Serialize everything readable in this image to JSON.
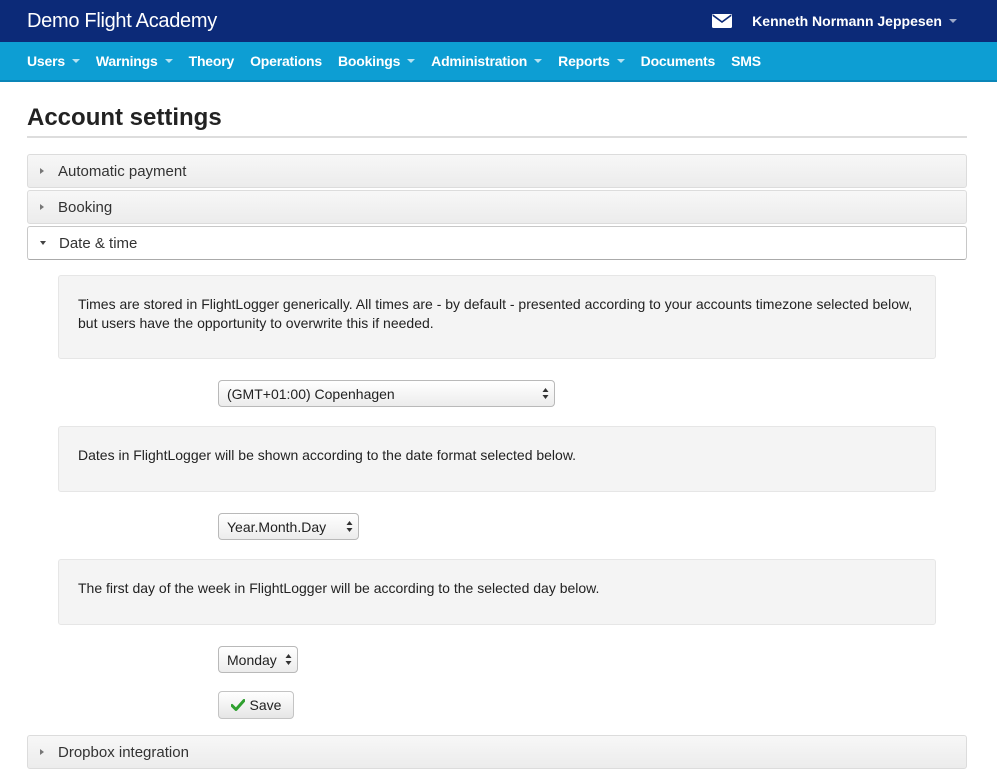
{
  "header": {
    "brand": "Demo Flight Academy",
    "user_name": "Kenneth Normann Jeppesen",
    "mail_icon": "mail-icon"
  },
  "nav": {
    "items": [
      {
        "label": "Users",
        "dropdown": true
      },
      {
        "label": "Warnings",
        "dropdown": true
      },
      {
        "label": "Theory",
        "dropdown": false
      },
      {
        "label": "Operations",
        "dropdown": false
      },
      {
        "label": "Bookings",
        "dropdown": true
      },
      {
        "label": "Administration",
        "dropdown": true
      },
      {
        "label": "Reports",
        "dropdown": true
      },
      {
        "label": "Documents",
        "dropdown": false
      },
      {
        "label": "SMS",
        "dropdown": false
      }
    ]
  },
  "page": {
    "title": "Account settings"
  },
  "panels": {
    "automatic_payment": "Automatic payment",
    "booking": "Booking",
    "date_time": "Date & time",
    "dropbox": "Dropbox integration"
  },
  "date_time": {
    "timezone_info": "Times are stored in FlightLogger generically. All times are - by default - presented according to your accounts timezone selected below, but users have the opportunity to overwrite this if needed.",
    "timezone_value": "(GMT+01:00) Copenhagen",
    "date_format_info": "Dates in FlightLogger will be shown according to the date format selected below.",
    "date_format_value": "Year.Month.Day",
    "week_start_info": "The first day of the week in FlightLogger will be according to the selected day below.",
    "week_start_value": "Monday",
    "save_label": "Save"
  },
  "colors": {
    "topbar": "#0c2a78",
    "navbar": "#0d9ed3",
    "save_check": "#2fa02f"
  }
}
